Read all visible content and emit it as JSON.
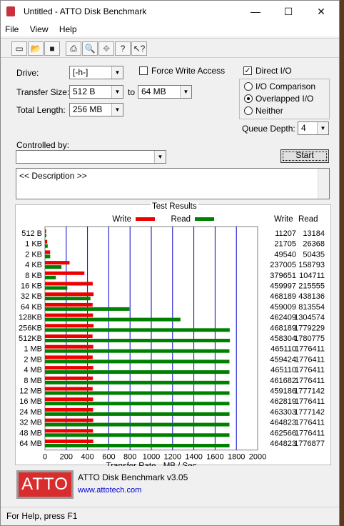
{
  "window": {
    "title": "Untitled - ATTO Disk Benchmark",
    "min": "—",
    "max": "☐",
    "close": "✕"
  },
  "menu": [
    "File",
    "View",
    "Help"
  ],
  "toolbar": {
    "icons": [
      "new-icon",
      "open-icon",
      "save-icon",
      "print-icon",
      "print-preview-icon",
      "move-icon",
      "help-icon",
      "context-help-icon"
    ]
  },
  "form": {
    "drive_label": "Drive:",
    "drive_value": "[-h-]",
    "force_write_label": "Force Write Access",
    "force_write_checked": false,
    "direct_io_label": "Direct I/O",
    "direct_io_checked": true,
    "transfer_size_label": "Transfer Size:",
    "transfer_from": "512 B",
    "to_label": "to",
    "transfer_to": "64 MB",
    "total_length_label": "Total Length:",
    "total_length_value": "256 MB",
    "radios": [
      {
        "label": "I/O Comparison",
        "selected": false
      },
      {
        "label": "Overlapped I/O",
        "selected": true
      },
      {
        "label": "Neither",
        "selected": false
      }
    ],
    "queue_depth_label": "Queue Depth:",
    "queue_depth_value": "4",
    "controlled_by_label": "Controlled by:",
    "controlled_by_value": "",
    "start_label": "Start",
    "description": "<< Description >>"
  },
  "chart_data": {
    "type": "bar",
    "title": "Test Results",
    "xlabel": "Transfer Rate - MB / Sec",
    "xlim": [
      0,
      2000
    ],
    "xticks": [
      "0",
      "200",
      "400",
      "600",
      "800",
      "1000",
      "1200",
      "1400",
      "1600",
      "1800",
      "2000"
    ],
    "legend": [
      "Write",
      "Read"
    ],
    "colors": {
      "write": "#ee0000",
      "read": "#008000",
      "grid": "#0000cc"
    },
    "col_write": "Write",
    "col_read": "Read",
    "categories": [
      "512 B",
      "1 KB",
      "2 KB",
      "4 KB",
      "8 KB",
      "16 KB",
      "32 KB",
      "64 KB",
      "128KB",
      "256KB",
      "512KB",
      "1 MB",
      "2 MB",
      "4 MB",
      "8 MB",
      "12 MB",
      "16 MB",
      "24 MB",
      "32 MB",
      "48 MB",
      "64 MB"
    ],
    "series": [
      {
        "name": "Write",
        "values": [
          11207,
          21705,
          49540,
          237005,
          379651,
          459997,
          468189,
          459009,
          462409,
          468189,
          458304,
          465110,
          459424,
          465110,
          461682,
          459186,
          462819,
          463303,
          464823,
          462566,
          464823
        ]
      },
      {
        "name": "Read",
        "values": [
          13184,
          26368,
          50435,
          158793,
          104711,
          215555,
          438136,
          813554,
          1304574,
          1779229,
          1780775,
          1776411,
          1776411,
          1776411,
          1776411,
          1777142,
          1776411,
          1777142,
          1776411,
          1776411,
          1776877
        ]
      }
    ]
  },
  "footer": {
    "logo": "ATTO",
    "product": "ATTO Disk Benchmark v3.05",
    "url": "www.attotech.com"
  },
  "status": "For Help, press F1"
}
